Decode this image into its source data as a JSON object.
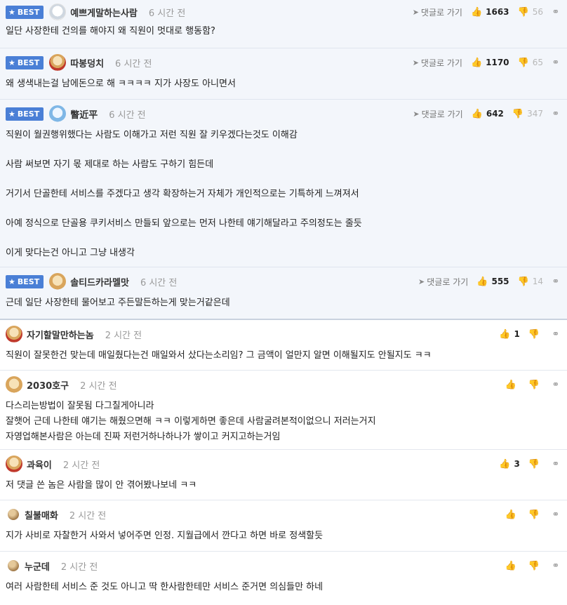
{
  "comments": [
    {
      "best": true,
      "badge": "BEST",
      "nick": "예쁘게말하는사람",
      "time": "6 시간 전",
      "goto": "댓글로 가기",
      "up": "1663",
      "down": "56",
      "lines": [
        "일단 사장한테 건의를 해야지 왜 직원이 멋대로 행동함?"
      ]
    },
    {
      "best": true,
      "badge": "BEST",
      "nick": "따봉덩치",
      "time": "6 시간 전",
      "goto": "댓글로 가기",
      "up": "1170",
      "down": "65",
      "lines": [
        "왜 생색내는걸 남에돈으로 해 ㅋㅋㅋㅋ 지가 사장도 아니면서"
      ]
    },
    {
      "best": true,
      "badge": "BEST",
      "nick": "瞥近平",
      "time": "6 시간 전",
      "goto": "댓글로 가기",
      "up": "642",
      "down": "347",
      "lines": [
        "직원이 월권행위했다는 사람도 이해가고 저런 직원 잘 키우겠다는것도 이해감",
        "사람 써보면 자기 몫 제대로 하는 사람도 구하기 힘든데",
        "거기서 단골한테 서비스를 주겠다고 생각 확장하는거 자체가 개인적으로는 기특하게 느껴져서",
        "아예 정식으로 단골용 쿠키서비스 만들되 앞으로는 먼저 나한테 얘기해달라고 주의정도는 줄듯",
        "이게 맞다는건 아니고 그냥 내생각"
      ]
    },
    {
      "best": true,
      "badge": "BEST",
      "nick": "솔티드카라멜맛",
      "time": "6 시간 전",
      "goto": "댓글로 가기",
      "up": "555",
      "down": "14",
      "lines": [
        "근데 일단 사장한테 물어보고 주든말든하는게 맞는거같은데"
      ]
    },
    {
      "best": false,
      "nick": "자기할말만하는놈",
      "time": "2 시간 전",
      "up": "1",
      "down": "",
      "lines": [
        "직원이 잘못한건 맞는데 매일줬다는건 매일와서 샀다는소리임? 그 금액이 얼만지 알면 이해될지도 안될지도 ㅋㅋ"
      ]
    },
    {
      "best": false,
      "nick": "2030호구",
      "time": "2 시간 전",
      "up": "",
      "down": "",
      "lines": [
        "다스리는방법이 잘못됨 다그칠게아니라",
        "잘햇어 근데 나한테 얘기는 해줬으면해 ㅋㅋ 이렇게하면 좋은데 사람굴려본적이없으니 저러는거지",
        "자영업해본사람은 아는데 진짜 저런거하나하나가 쌓이고 커지고하는거임"
      ]
    },
    {
      "best": false,
      "nick": "과육이",
      "time": "2 시간 전",
      "up": "3",
      "down": "",
      "lines": [
        "저 댓글 쓴 놈은 사람을 많이 안 겪어봤나보네 ㅋㅋ"
      ]
    },
    {
      "best": false,
      "nick": "칠불매화",
      "time": "2 시간 전",
      "up": "",
      "down": "",
      "lines": [
        "지가 사비로 자찰한거 사와서 넣어주면 인정. 지월급에서 깐다고 하면 바로 정색할듯"
      ]
    },
    {
      "best": false,
      "nick": "누군데",
      "time": "2 시간 전",
      "up": "",
      "down": "",
      "lines": [
        "여러 사람한테 서비스 준 것도 아니고 딱 한사람한테만 서비스 준거면 의심들만 하네"
      ]
    }
  ],
  "icons": {
    "star": "star-icon",
    "goto": "arrow-icon",
    "up": "thumbs-up-icon",
    "down": "thumbs-down-icon",
    "share": "share-icon"
  },
  "colors": {
    "best_badge": "#4a7fd6",
    "best_bg": "#f3f6fb"
  }
}
